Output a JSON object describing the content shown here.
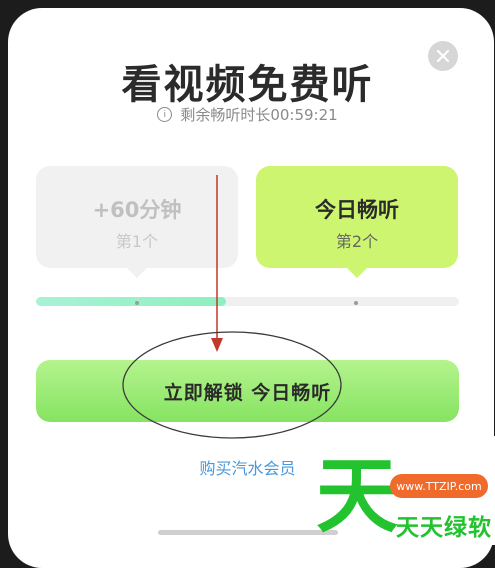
{
  "dialog": {
    "title": "看视频免费听",
    "remaining_label": "剩余畅听时长00:59:21",
    "close_icon": "close-icon",
    "info_icon_glyph": "i"
  },
  "options": [
    {
      "title": "+60分钟",
      "subtitle": "第1个",
      "state": "disabled"
    },
    {
      "title": "今日畅听",
      "subtitle": "第2个",
      "state": "selected"
    }
  ],
  "progress": {
    "fraction": 0.45,
    "steps": 2
  },
  "actions": {
    "unlock_label": "立即解锁 今日畅听",
    "member_link": "购买汽水会员"
  },
  "watermark": {
    "big_char": "天",
    "url": "www.TTZIP.com",
    "name": "天天绿软"
  },
  "colors": {
    "accent_green": "#86e361",
    "selected_card": "#cdf56f",
    "link_blue": "#4b98d8",
    "watermark_green": "#22c32e",
    "watermark_orange": "#f06a2c",
    "annotation_red": "#c0392b"
  }
}
